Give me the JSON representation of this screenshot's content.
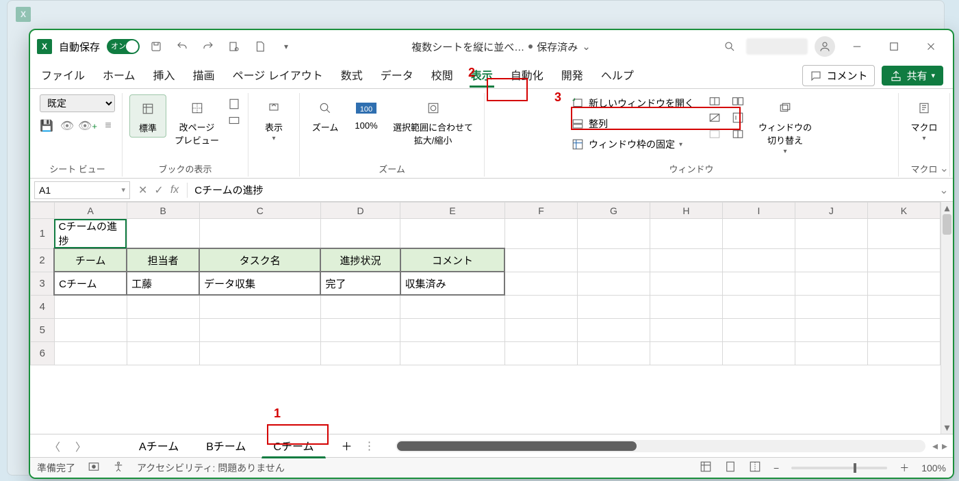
{
  "titlebar": {
    "autosave_label": "自動保存",
    "autosave_on": "オン",
    "filename": "複数シートを縦に並べ…",
    "saved_state": "保存済み"
  },
  "tabs": {
    "items": [
      "ファイル",
      "ホーム",
      "挿入",
      "描画",
      "ページ レイアウト",
      "数式",
      "データ",
      "校閲",
      "表示",
      "自動化",
      "開発",
      "ヘルプ"
    ],
    "active_index": 8,
    "comment_btn": "コメント",
    "share_btn": "共有"
  },
  "ribbon": {
    "view_select": "既定",
    "group_sheetview": "シート ビュー",
    "btn_normal": "標準",
    "btn_pagebreak": "改ページ\nプレビュー",
    "btn_show": "表示",
    "group_bookview": "ブックの表示",
    "btn_zoom": "ズーム",
    "btn_100": "100%",
    "btn_fitsel": "選択範囲に合わせて\n拡大/縮小",
    "group_zoom": "ズーム",
    "btn_newwindow": "新しいウィンドウを開く",
    "btn_arrange": "整列",
    "btn_freeze": "ウィンドウ枠の固定",
    "btn_switch": "ウィンドウの\n切り替え",
    "group_window": "ウィンドウ",
    "btn_macro": "マクロ",
    "group_macro": "マクロ"
  },
  "formula_bar": {
    "name_box": "A1",
    "fx": "fx",
    "value": "Cチームの進捗"
  },
  "grid": {
    "columns": [
      "A",
      "B",
      "C",
      "D",
      "E",
      "F",
      "G",
      "H",
      "I",
      "J",
      "K"
    ],
    "rows": [
      1,
      2,
      3,
      4,
      5,
      6
    ],
    "cells": {
      "A1": "Cチームの進捗",
      "A2": "チーム",
      "B2": "担当者",
      "C2": "タスク名",
      "D2": "進捗状況",
      "E2": "コメント",
      "A3": "Cチーム",
      "B3": "工藤",
      "C3": "データ収集",
      "D3": "完了",
      "E3": "収集済み"
    }
  },
  "sheet_tabs": {
    "items": [
      "Aチーム",
      "Bチーム",
      "Cチーム"
    ],
    "active_index": 2
  },
  "statusbar": {
    "ready": "準備完了",
    "accessibility": "アクセシビリティ: 問題ありません",
    "zoom": "100%"
  },
  "annotations": {
    "a1": "1",
    "a2": "2",
    "a3": "3"
  }
}
